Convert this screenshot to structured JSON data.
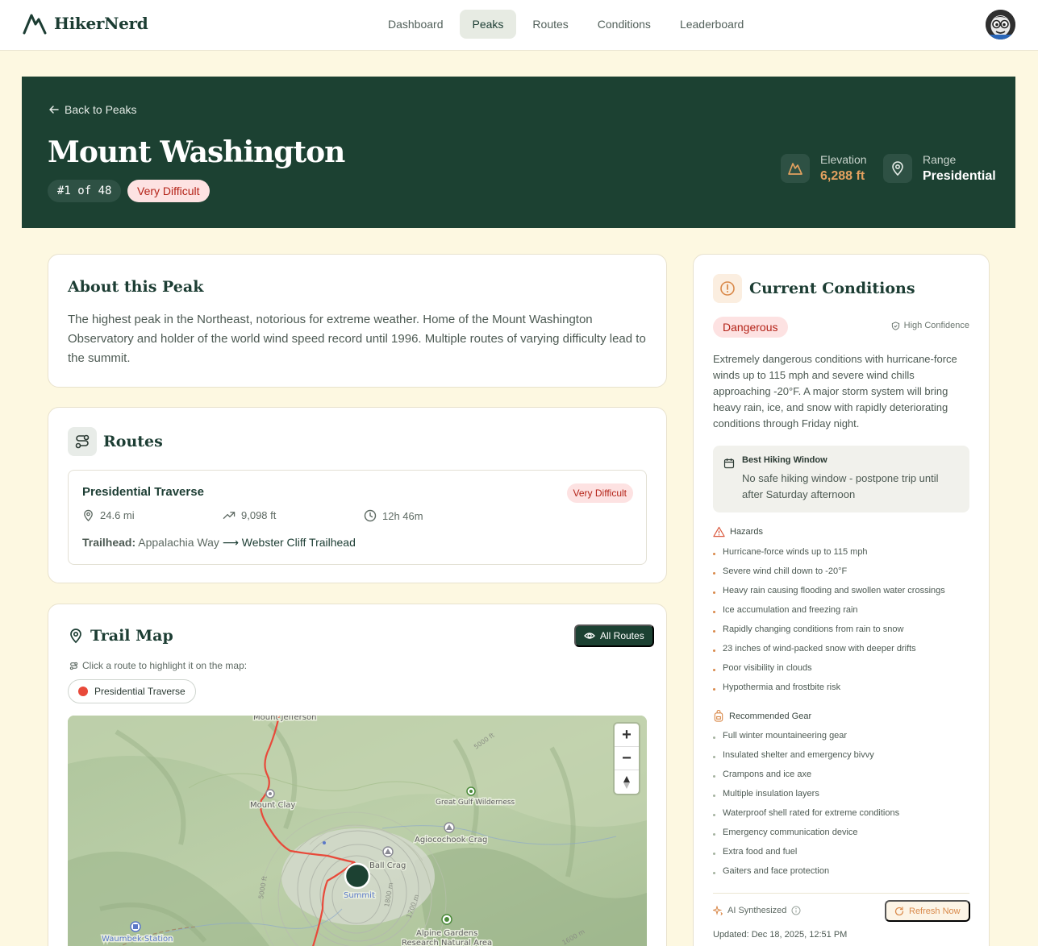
{
  "app": {
    "name": "HikerNerd"
  },
  "nav": {
    "links": [
      {
        "label": "Dashboard",
        "active": false
      },
      {
        "label": "Peaks",
        "active": true
      },
      {
        "label": "Routes",
        "active": false
      },
      {
        "label": "Conditions",
        "active": false
      },
      {
        "label": "Leaderboard",
        "active": false
      }
    ]
  },
  "hero": {
    "back_label": "Back to Peaks",
    "title": "Mount Washington",
    "rank": "#1 of 48",
    "difficulty": "Very Difficult",
    "elevation_label": "Elevation",
    "elevation_value": "6,288 ft",
    "range_label": "Range",
    "range_value": "Presidential"
  },
  "about": {
    "title": "About this Peak",
    "text": "The highest peak in the Northeast, notorious for extreme weather. Home of the Mount Washington Observatory and holder of the world wind speed record until 1996. Multiple routes of varying difficulty lead to the summit."
  },
  "routes": {
    "title": "Routes",
    "items": [
      {
        "name": "Presidential Traverse",
        "difficulty": "Very Difficult",
        "distance": "24.6 mi",
        "gain": "9,098 ft",
        "time": "12h 46m",
        "trailhead_label": "Trailhead:",
        "trailhead_from": "Appalachia Way",
        "trailhead_arrow": "⟶",
        "trailhead_to": "Webster Cliff Trailhead"
      }
    ]
  },
  "trail_map": {
    "title": "Trail Map",
    "all_routes_label": "All Routes",
    "hint": "Click a route to highlight it on the map:",
    "route_chip": "Presidential Traverse",
    "route_color": "#e8493a",
    "labels": {
      "mount_jefferson": "Mount Jefferson",
      "mount_clay": "Mount Clay",
      "great_gulf": "Great Gulf Wilderness",
      "agiocochook": "Agiocochook Crag",
      "ball_crag": "Ball Crag",
      "summit": "Summit",
      "alpine_gardens": "Alpine Gardens",
      "research_area": "Research Natural Area",
      "waumbek": "Waumbek Station",
      "contour_1": "5000 ft",
      "contour_2": "1800 m",
      "contour_3": "1700 m",
      "contour_4": "5000 ft",
      "contour_5": "1600 m"
    },
    "zoom_in": "+",
    "zoom_out": "−"
  },
  "conditions": {
    "title": "Current Conditions",
    "status": "Dangerous",
    "confidence": "High Confidence",
    "summary": "Extremely dangerous conditions with hurricane-force winds up to 115 mph and severe wind chills approaching -20°F. A major storm system will bring heavy rain, ice, and snow with rapidly deteriorating conditions through Friday night.",
    "window_title": "Best Hiking Window",
    "window_text": "No safe hiking window - postpone trip until after Saturday afternoon",
    "hazards_title": "Hazards",
    "hazards": [
      "Hurricane-force winds up to 115 mph",
      "Severe wind chill down to -20°F",
      "Heavy rain causing flooding and swollen water crossings",
      "Ice accumulation and freezing rain",
      "Rapidly changing conditions from rain to snow",
      "23 inches of wind-packed snow with deeper drifts",
      "Poor visibility in clouds",
      "Hypothermia and frostbite risk"
    ],
    "gear_title": "Recommended Gear",
    "gear": [
      "Full winter mountaineering gear",
      "Insulated shelter and emergency bivvy",
      "Crampons and ice axe",
      "Multiple insulation layers",
      "Waterproof shell rated for extreme conditions",
      "Emergency communication device",
      "Extra food and fuel",
      "Gaiters and face protection"
    ],
    "ai_label": "AI Synthesized",
    "refresh_label": "Refresh Now",
    "updated": "Updated: Dec 18, 2025, 12:51 PM"
  },
  "colors": {
    "brand_dark": "#1c4132",
    "accent": "#d9894a",
    "danger": "#b42318",
    "background": "#fdf8e1"
  }
}
